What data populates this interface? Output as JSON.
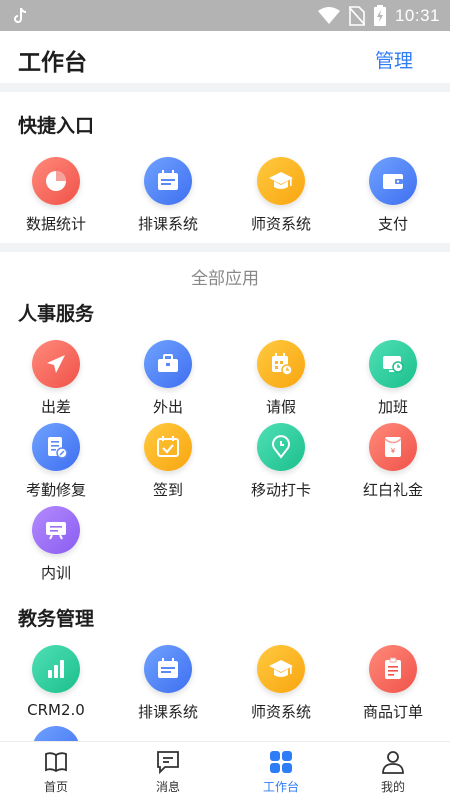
{
  "status_bar": {
    "time": "10:31"
  },
  "header": {
    "title": "工作台",
    "manage_label": "管理"
  },
  "quick_entry": {
    "title": "快捷入口",
    "items": [
      {
        "label": "数据统计",
        "icon": "pie-chart-icon",
        "color": "#f0524a"
      },
      {
        "label": "排课系统",
        "icon": "schedule-icon",
        "color": "#3f6ff0"
      },
      {
        "label": "师资系统",
        "icon": "graduation-cap-icon",
        "color": "#f9a610"
      },
      {
        "label": "支付",
        "icon": "wallet-icon",
        "color": "#3f6ff0"
      }
    ]
  },
  "all_apps_label": "全部应用",
  "hr_services": {
    "title": "人事服务",
    "items": [
      {
        "label": "出差",
        "icon": "airplane-icon",
        "color": "#f0524a"
      },
      {
        "label": "外出",
        "icon": "briefcase-icon",
        "color": "#3f6ff0"
      },
      {
        "label": "请假",
        "icon": "calendar-clock-icon",
        "color": "#f9a610"
      },
      {
        "label": "加班",
        "icon": "monitor-clock-icon",
        "color": "#1cbf8c"
      },
      {
        "label": "考勤修复",
        "icon": "document-edit-icon",
        "color": "#3f6ff0"
      },
      {
        "label": "签到",
        "icon": "calendar-check-icon",
        "color": "#f9a610"
      },
      {
        "label": "移动打卡",
        "icon": "location-clock-icon",
        "color": "#1cbf8c"
      },
      {
        "label": "红白礼金",
        "icon": "red-envelope-icon",
        "color": "#f0524a"
      },
      {
        "label": "内训",
        "icon": "training-board-icon",
        "color": "#8a5cf0"
      }
    ]
  },
  "edu_management": {
    "title": "教务管理",
    "items": [
      {
        "label": "CRM2.0",
        "icon": "bar-chart-icon",
        "color": "#1cbf8c"
      },
      {
        "label": "排课系统",
        "icon": "schedule-icon",
        "color": "#3f6ff0"
      },
      {
        "label": "师资系统",
        "icon": "graduation-cap-icon",
        "color": "#f9a610"
      },
      {
        "label": "商品订单",
        "icon": "order-list-icon",
        "color": "#f0524a"
      }
    ]
  },
  "tab_bar": {
    "items": [
      {
        "label": "首页",
        "icon": "book-icon"
      },
      {
        "label": "消息",
        "icon": "message-icon"
      },
      {
        "label": "工作台",
        "icon": "grid-icon",
        "active": true
      },
      {
        "label": "我的",
        "icon": "user-icon"
      }
    ]
  }
}
